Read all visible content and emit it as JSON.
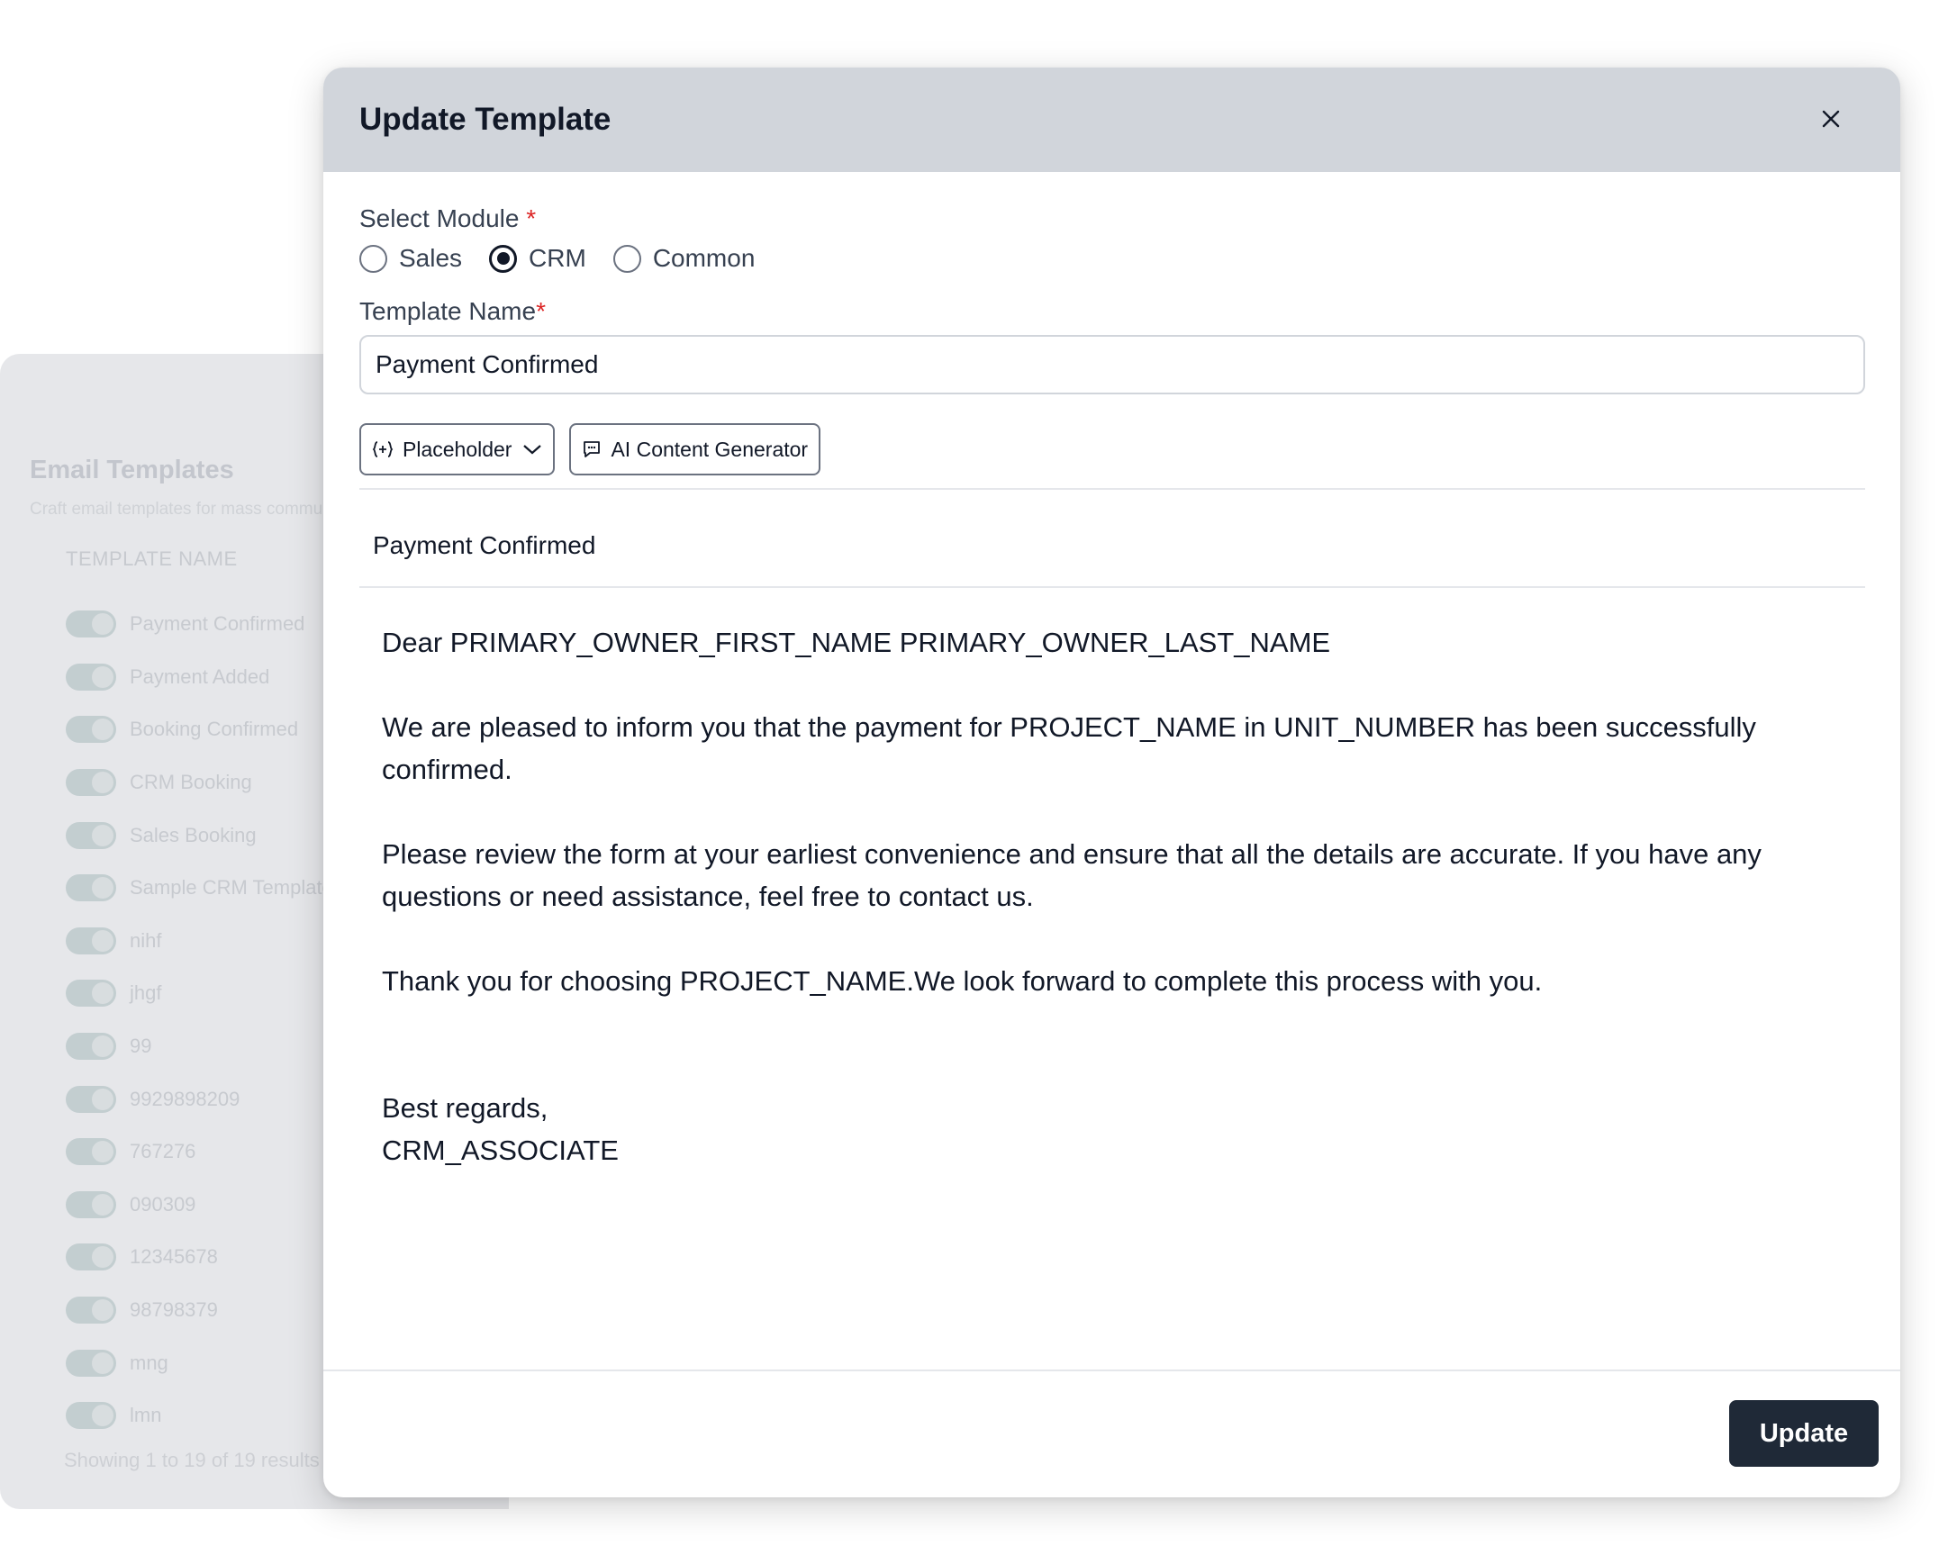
{
  "background_page": {
    "title": "Email Templates",
    "subtitle": "Craft email templates for mass communication",
    "column_header": "TEMPLATE NAME",
    "rows": [
      {
        "label": "Payment Confirmed"
      },
      {
        "label": "Payment Added"
      },
      {
        "label": "Booking Confirmed"
      },
      {
        "label": "CRM Booking"
      },
      {
        "label": "Sales Booking"
      },
      {
        "label": "Sample CRM Template"
      },
      {
        "label": "nihf"
      },
      {
        "label": "jhgf"
      },
      {
        "label": "99"
      },
      {
        "label": "9929898209"
      },
      {
        "label": "767276"
      },
      {
        "label": "090309"
      },
      {
        "label": "12345678"
      },
      {
        "label": "98798379"
      },
      {
        "label": "mng"
      },
      {
        "label": "lmn"
      }
    ],
    "footer": "Showing 1 to 19 of 19 results"
  },
  "modal": {
    "title": "Update Template",
    "module_label": "Select Module",
    "required_mark": "*",
    "modules": [
      {
        "label": "Sales",
        "checked": false
      },
      {
        "label": "CRM",
        "checked": true
      },
      {
        "label": "Common",
        "checked": false
      }
    ],
    "template_name_label": "Template Name",
    "template_name_value": "Payment Confirmed",
    "toolbar": {
      "placeholder_label": "Placeholder",
      "ai_label": "AI Content Generator"
    },
    "subject": "Payment Confirmed",
    "body": {
      "greeting": "Dear PRIMARY_OWNER_FIRST_NAME PRIMARY_OWNER_LAST_NAME",
      "para1": "We are pleased to inform you that the payment for PROJECT_NAME in UNIT_NUMBER has been successfully confirmed.",
      "para2": "Please review the form at your earliest convenience and ensure that all the details are accurate. If you have any questions or need assistance, feel free to contact us.",
      "para3": "Thank you for choosing PROJECT_NAME.We look forward to complete this process with you.",
      "signoff": "Best regards,",
      "signature": "CRM_ASSOCIATE"
    },
    "update_label": "Update"
  },
  "colors": {
    "header_bg": "#d1d5db",
    "primary_button": "#1f2937",
    "required": "#dc2626"
  }
}
